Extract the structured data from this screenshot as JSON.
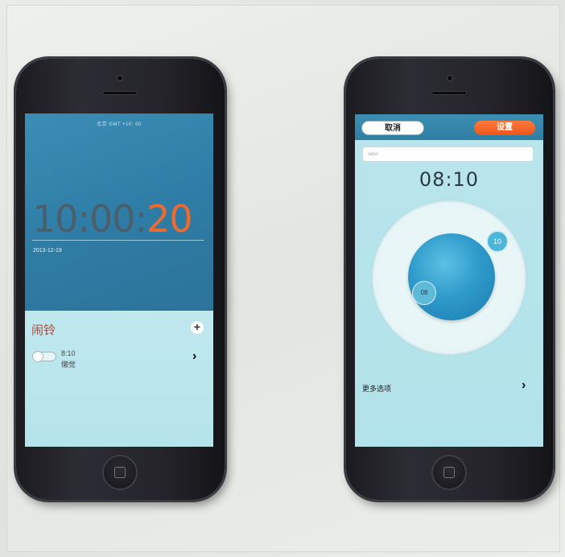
{
  "left_phone": {
    "status_text": "北京 GMT +10: 00",
    "time": {
      "hm": "10:00:",
      "seconds": "20"
    },
    "date": "2013-12-19",
    "alarm_title": "闹铃",
    "add_symbol": "+",
    "alarm_item": {
      "time": "8:10",
      "label": "懒觉",
      "enabled": false
    },
    "chevron": "›"
  },
  "right_phone": {
    "cancel_label": "取消",
    "set_label": "设置",
    "label_placeholder": "label",
    "time": "08:10",
    "minute_value": "10",
    "hour_value": "08",
    "more_options_label": "更多选项",
    "chevron": "›"
  },
  "colors": {
    "accent_orange": "#f06a2e",
    "header_blue": "#2f7ea6",
    "panel_teal": "#bfe8ee"
  }
}
